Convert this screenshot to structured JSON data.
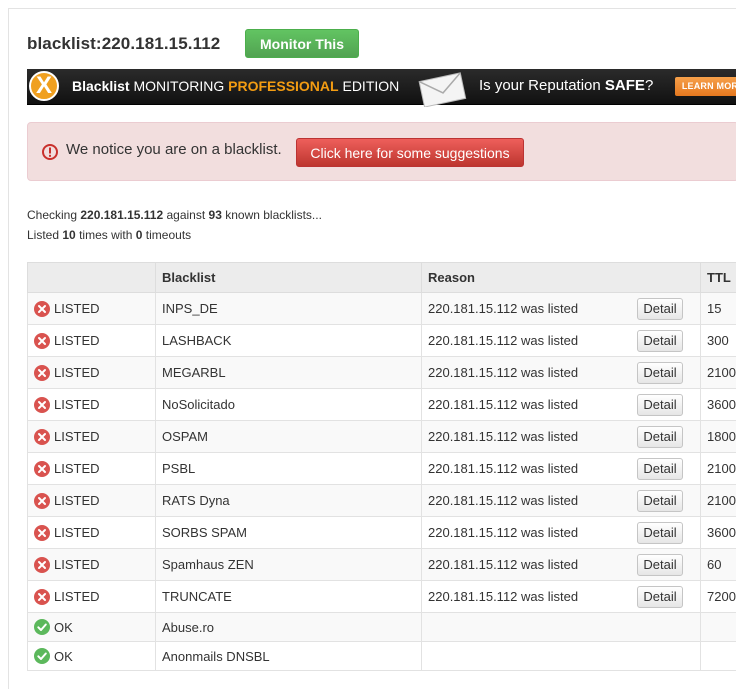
{
  "header": {
    "title": "blacklist:220.181.15.112",
    "monitor_label": "Monitor This"
  },
  "banner": {
    "logo_letter": "X",
    "text_bold": "Blacklist",
    "text_mid": "MONITORING",
    "text_orange": "PROFESSIONAL",
    "text_end": "EDITION",
    "question_prefix": "Is your Reputation",
    "question_bold": "SAFE",
    "question_suffix": "?",
    "learn_more": "LEARN MORE ▶"
  },
  "alert": {
    "message": "We notice you are on a blacklist.",
    "button_label": "Click here for some suggestions"
  },
  "summary": {
    "checking_prefix": "Checking",
    "ip": "220.181.15.112",
    "against": "against",
    "count": "93",
    "known": "known blacklists...",
    "listed_prefix": "Listed",
    "listed_count": "10",
    "times_with": "times with",
    "timeouts_count": "0",
    "timeouts": "timeouts"
  },
  "table": {
    "columns": [
      "",
      "Blacklist",
      "Reason",
      "TTL"
    ],
    "detail_label": "Detail",
    "rows": [
      {
        "status": "LISTED",
        "blacklist": "INPS_DE",
        "reason": "220.181.15.112 was listed",
        "ttl": "15"
      },
      {
        "status": "LISTED",
        "blacklist": "LASHBACK",
        "reason": "220.181.15.112 was listed",
        "ttl": "300"
      },
      {
        "status": "LISTED",
        "blacklist": "MEGARBL",
        "reason": "220.181.15.112 was listed",
        "ttl": "2100"
      },
      {
        "status": "LISTED",
        "blacklist": "NoSolicitado",
        "reason": "220.181.15.112 was listed",
        "ttl": "3600"
      },
      {
        "status": "LISTED",
        "blacklist": "OSPAM",
        "reason": "220.181.15.112 was listed",
        "ttl": "1800"
      },
      {
        "status": "LISTED",
        "blacklist": "PSBL",
        "reason": "220.181.15.112 was listed",
        "ttl": "2100"
      },
      {
        "status": "LISTED",
        "blacklist": "RATS Dyna",
        "reason": "220.181.15.112 was listed",
        "ttl": "2100"
      },
      {
        "status": "LISTED",
        "blacklist": "SORBS SPAM",
        "reason": "220.181.15.112 was listed",
        "ttl": "3600"
      },
      {
        "status": "LISTED",
        "blacklist": "Spamhaus ZEN",
        "reason": "220.181.15.112 was listed",
        "ttl": "60"
      },
      {
        "status": "LISTED",
        "blacklist": "TRUNCATE",
        "reason": "220.181.15.112 was listed",
        "ttl": "7200"
      },
      {
        "status": "OK",
        "blacklist": "Abuse.ro",
        "reason": "",
        "ttl": ""
      },
      {
        "status": "OK",
        "blacklist": "Anonmails DNSBL",
        "reason": "",
        "ttl": ""
      }
    ]
  },
  "colors": {
    "listed": "#d9534f",
    "ok": "#5cb85c",
    "monitor_button": "#5cb85c",
    "alert_background": "#f2dede",
    "suggest_button": "#d9534f",
    "banner_background": "#1b1b1b",
    "banner_accent": "#f39c12"
  },
  "icons": {
    "listed": "x-circle-icon",
    "ok": "check-circle-icon",
    "alert": "exclamation-circle-icon",
    "envelope": "envelope-icon"
  }
}
